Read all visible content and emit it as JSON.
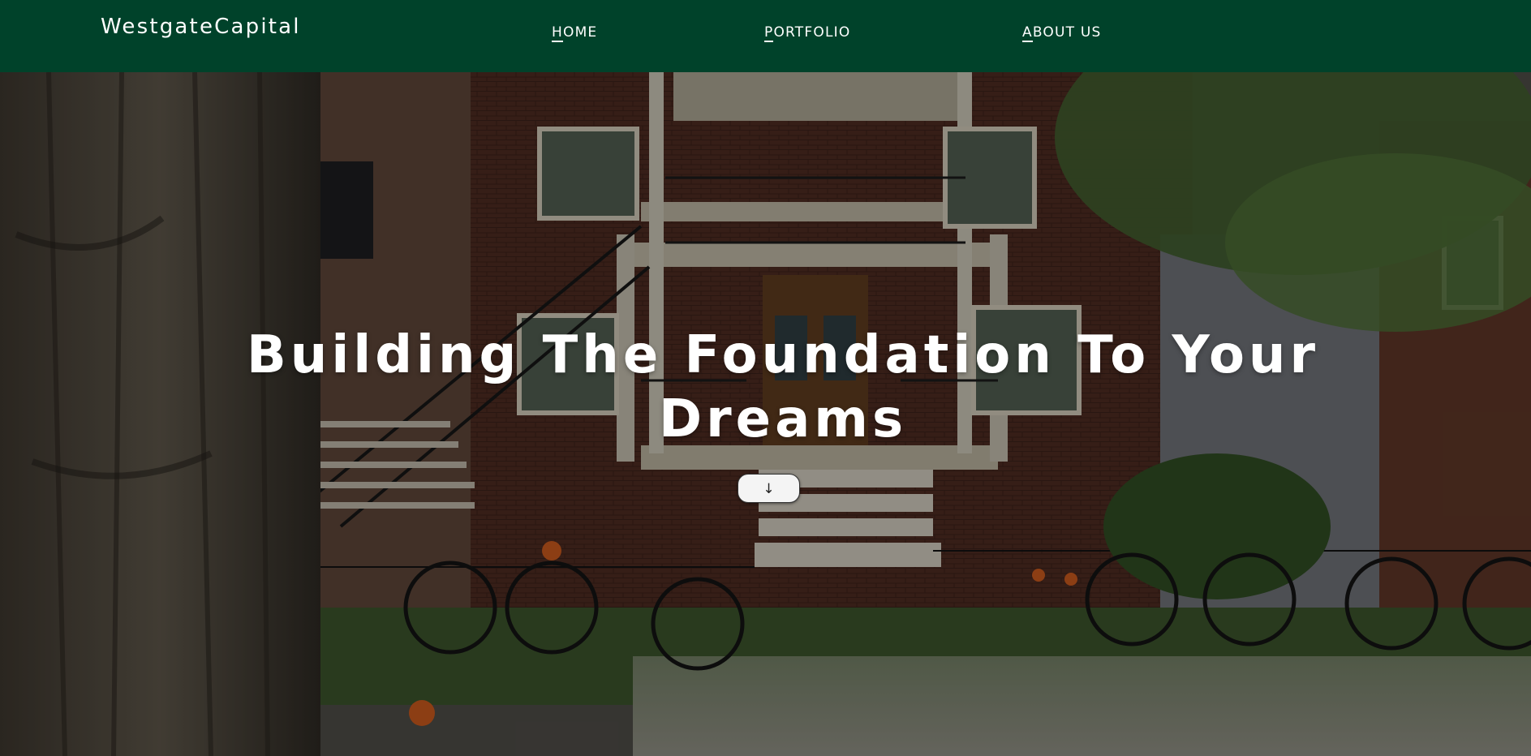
{
  "header": {
    "logo": "WestgateCapital",
    "nav": [
      {
        "first": "H",
        "rest": "OME"
      },
      {
        "first": "P",
        "rest": "ORTFOLIO"
      },
      {
        "first": "A",
        "rest": "BOUT US"
      }
    ]
  },
  "hero": {
    "title_line1": "Building The Foundation To Your",
    "title_line2": "Dreams",
    "scroll_button": "↓",
    "background_image": "brick apartment building with balconies, exterior staircase, bicycles and a tree"
  },
  "colors": {
    "header_bg": "#00422a",
    "text": "#ffffff",
    "button_bg": "#f4f4f4"
  },
  "icons": {
    "scroll": "down-arrow-icon"
  }
}
